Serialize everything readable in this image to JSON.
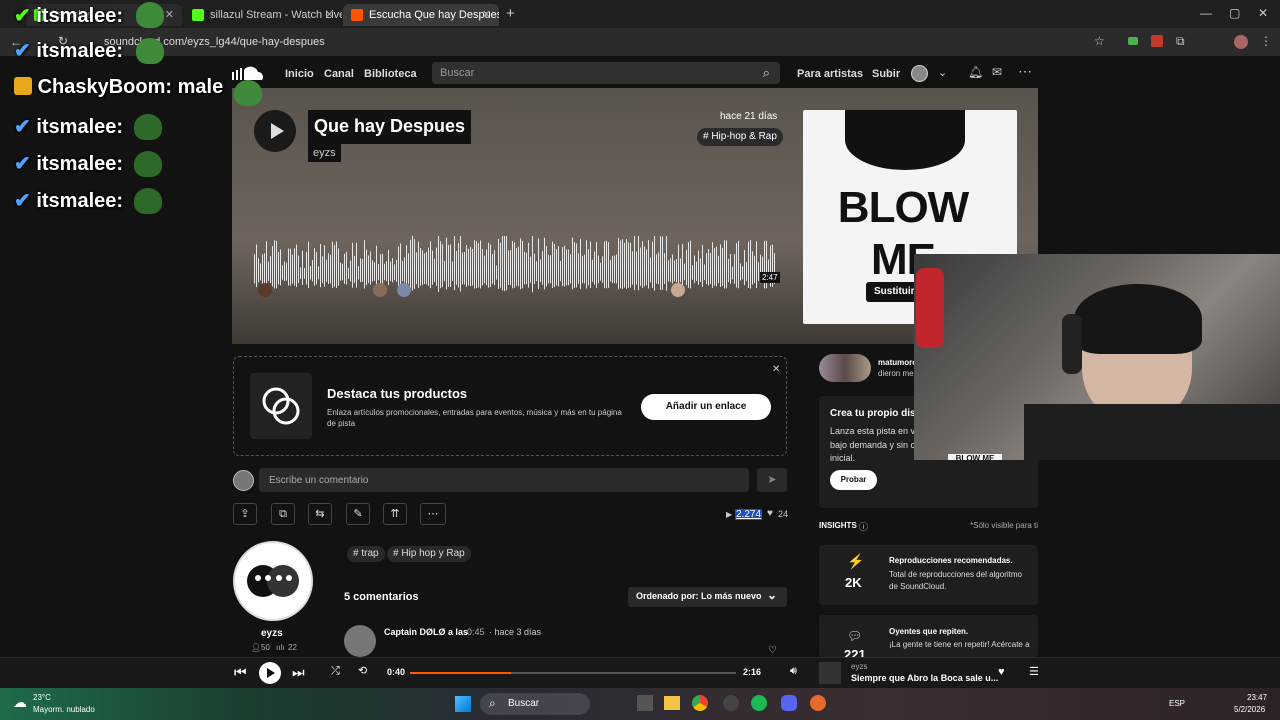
{
  "browser": {
    "tabs": [
      {
        "label": "itsmalee",
        "color": "#53fc18"
      },
      {
        "label": "sillazul Stream - Watch Live on",
        "color": "#53fc18"
      },
      {
        "label": "Escucha Que hay Despues de e",
        "color": "#ff5500"
      }
    ],
    "url": "soundcloud.com/eyzs_lg44/que-hay-despues"
  },
  "chat": [
    {
      "user": "itsmalee:"
    },
    {
      "user": "itsmalee:"
    },
    {
      "user": "ChaskyBoom:",
      "text": "male"
    },
    {
      "user": "itsmalee:"
    },
    {
      "user": "itsmalee:"
    },
    {
      "user": "itsmalee:"
    }
  ],
  "sc_header": {
    "nav": [
      "Inicio",
      "Canal",
      "Biblioteca"
    ],
    "search_placeholder": "Buscar",
    "for_artists": "Para artistas",
    "upload": "Subir"
  },
  "track": {
    "title": "Que hay Despues",
    "artist": "eyzs",
    "posted": "hace 21 días",
    "genre": "# Hip-hop & Rap",
    "duration": "2:47",
    "cover_text": "BLOW ME",
    "replace_label": "Sustituir i"
  },
  "promo": {
    "title": "Destaca tus productos",
    "desc": "Enlaza artículos promocionales, entradas para eventos, música y más en tu página de pista",
    "button": "Añadir un enlace"
  },
  "comment_placeholder": "Escribe un comentario",
  "stats": {
    "plays": "2.274",
    "likes": "24"
  },
  "tags": [
    "# trap",
    "# Hip hop y Rap"
  ],
  "uploader": {
    "name": "eyzs",
    "followers": "50",
    "tracks": "22"
  },
  "comments": {
    "count_label": "5 comentarios",
    "sort_label": "Ordenado por: Lo más nuevo",
    "first": {
      "author": "Captain DØLØ a las",
      "time": "0:45",
      "ago": "· hace 3 días"
    }
  },
  "sidebar": {
    "liked_by": "matumoro",
    "liked_by2": "dieron me",
    "create_title": "Crea tu propio dis",
    "create_desc1": "Lanza esta pista en v",
    "create_desc2": "bajo demanda y sin c",
    "create_desc3": "inicial.",
    "try_button": "Probar",
    "insights_label": "INSIGHTS",
    "insights_note": "*Sólo visible para ti",
    "card1": {
      "value": "2K",
      "title": "Reproducciones recomendadas.",
      "desc": "Total de reproducciones del algoritmo de SoundCloud."
    },
    "card2": {
      "value": "221",
      "title": "Oyentes que repiten.",
      "desc": "¡La gente te tiene en repetir! Acércate a"
    }
  },
  "player": {
    "elapsed": "0:40",
    "total": "2:16",
    "progress": 0.31,
    "artist": "eyzs",
    "title": "Siempre que Abro la Boca sale u..."
  },
  "taskbar": {
    "temp": "23°C",
    "weather": "Mayorm. nublado",
    "search": "Buscar",
    "lang": "ESP",
    "time": "23:47",
    "date": "5/2/2026"
  }
}
